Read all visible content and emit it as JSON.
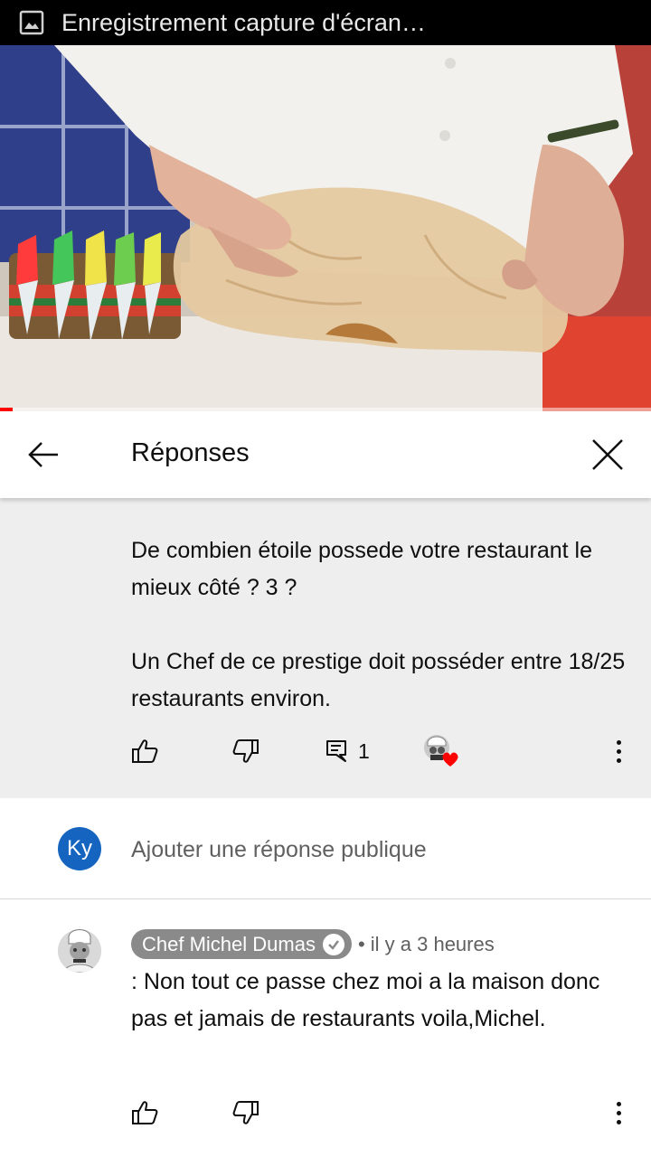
{
  "status_bar": {
    "title": "Enregistrement capture d'écran…",
    "icon": "image-icon"
  },
  "video": {
    "description_icon": "video-frame",
    "progress_fraction": 0.02,
    "progress_color": "#ff0000"
  },
  "header": {
    "title": "Réponses",
    "back_icon": "arrow-left-icon",
    "close_icon": "close-icon"
  },
  "parent_comment": {
    "text": "De combien étoile possede votre restaurant le mieux côté ? 3 ?\n\nUn Chef de ce prestige doit posséder entre 18/25 restaurants environ.",
    "reply_count": "1",
    "icons": [
      "thumb-up-icon",
      "thumb-down-icon",
      "reply-icon",
      "creator-heart-icon",
      "more-vert-icon"
    ]
  },
  "add_reply": {
    "avatar_initials": "Ky",
    "avatar_color": "#1565c0",
    "placeholder": "Ajouter une réponse publique"
  },
  "reply": {
    "author": "Chef Michel Dumas",
    "time": "• il y a 3 heures",
    "text": ": Non tout ce passe chez moi a la maison donc pas et jamais de restaurants voila,Michel.",
    "author_badge_color": "#8a8a8a",
    "icons": [
      "thumb-up-icon",
      "thumb-down-icon",
      "more-vert-icon"
    ]
  }
}
